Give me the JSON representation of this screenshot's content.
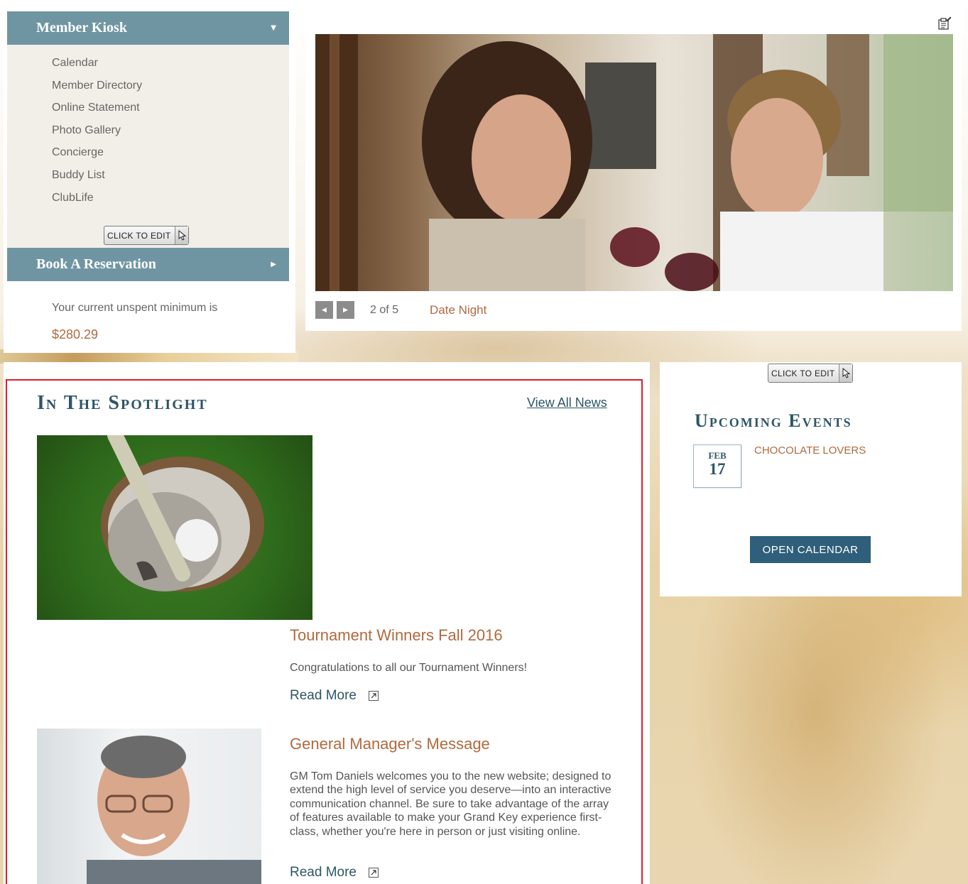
{
  "sidebar": {
    "kiosk_title": "Member Kiosk",
    "kiosk_items": [
      {
        "label": "Calendar"
      },
      {
        "label": "Member Directory"
      },
      {
        "label": "Online Statement"
      },
      {
        "label": "Photo Gallery"
      },
      {
        "label": "Concierge"
      },
      {
        "label": "Buddy List"
      },
      {
        "label": "ClubLife"
      }
    ],
    "edit_label": "CLICK TO EDIT",
    "reservation_title": "Book A Reservation",
    "minimum_text": "Your current unspent minimum is",
    "minimum_amount": "$280.29"
  },
  "slideshow": {
    "counter": "2 of 5",
    "caption": "Date Night",
    "prev_icon": "triangle-left",
    "next_icon": "triangle-right"
  },
  "spotlight": {
    "title": "In The Spotlight",
    "view_all": "View All News",
    "articles": [
      {
        "heading": "Tournament Winners Fall 2016",
        "text": "Congratulations to all our Tournament Winners!",
        "read_more": "Read More"
      },
      {
        "heading": "General Manager's Message",
        "text": "GM Tom Daniels welcomes you to the new website; designed to extend the high level of service you deserve—into an interactive communication channel. Be sure to take advantage of the array of features available to make your Grand Key experience first-class, whether you're here in person or just visiting online.",
        "read_more": "Read More"
      }
    ]
  },
  "events": {
    "edit_label": "CLICK TO EDIT",
    "title": "Upcoming Events",
    "items": [
      {
        "month": "FEB",
        "day": "17",
        "name": "CHOCOLATE LOVERS"
      }
    ],
    "open_calendar": "OPEN CALENDAR"
  },
  "colors": {
    "accordion_header": "#6f95a3",
    "heading_blue": "#2e5566",
    "accent_rust": "#b06a40",
    "button_blue": "#2f5f7a",
    "spotlight_border": "#d8202c"
  }
}
